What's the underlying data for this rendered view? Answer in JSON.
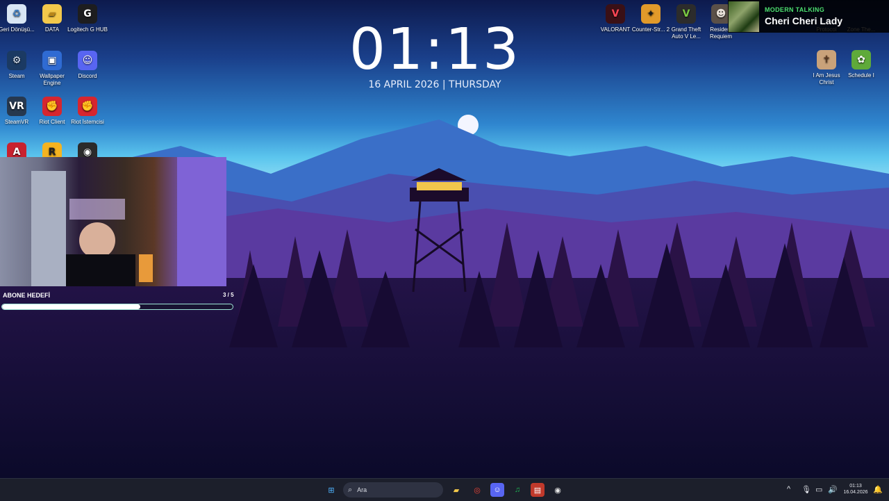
{
  "desktop_left": [
    {
      "name": "recycle-bin",
      "label": "Geri Dönüşü...",
      "glyph": "♻",
      "bg": "#d9e6f4",
      "fg": "#3b7cc4"
    },
    {
      "name": "data-folder",
      "label": "DATA",
      "glyph": "▰",
      "bg": "#f3c84b",
      "fg": "#b8861a"
    },
    {
      "name": "logitech-g-hub",
      "label": "Logitech G HUB",
      "glyph": "G",
      "bg": "#1d1d1f",
      "fg": "#ffffff"
    },
    {
      "name": "steam",
      "label": "Steam",
      "glyph": "⚙",
      "bg": "#1b3a63",
      "fg": "#dfe8f5"
    },
    {
      "name": "wallpaper-engine",
      "label": "Wallpaper Engine",
      "glyph": "▣",
      "bg": "#2f6bd3",
      "fg": "#ffffff"
    },
    {
      "name": "discord",
      "label": "Discord",
      "glyph": "☺",
      "bg": "#5865f2",
      "fg": "#ffffff"
    },
    {
      "name": "steamvr",
      "label": "SteamVR",
      "glyph": "VR",
      "bg": "#26384f",
      "fg": "#ffffff"
    },
    {
      "name": "riot-client",
      "label": "Riot Client",
      "glyph": "✊",
      "bg": "#d6262f",
      "fg": "#ffffff"
    },
    {
      "name": "riot-istemcisi",
      "label": "Riot İstemcisi",
      "glyph": "✊",
      "bg": "#d6262f",
      "fg": "#ffffff"
    },
    {
      "name": "adobe-app",
      "label": "",
      "glyph": "A",
      "bg": "#c8222f",
      "fg": "#ffffff"
    },
    {
      "name": "rockstar",
      "label": "",
      "glyph": "R",
      "bg": "#f4b321",
      "fg": "#222222"
    },
    {
      "name": "obs",
      "label": "",
      "glyph": "◉",
      "bg": "#2b2b2b",
      "fg": "#ffffff"
    }
  ],
  "desktop_right": [
    {
      "name": "valorant",
      "label": "VALORANT",
      "glyph": "V",
      "bg": "#3a1016",
      "fg": "#ff4655"
    },
    {
      "name": "counter-strike",
      "label": "Counter-Str... 2",
      "glyph": "✦",
      "bg": "#e29a2a",
      "fg": "#1a1a1a"
    },
    {
      "name": "gta-v",
      "label": "Grand Theft Auto V Le...",
      "glyph": "V",
      "bg": "#2c2c2c",
      "fg": "#7ac943"
    },
    {
      "name": "resident-evil",
      "label": "Resident Requiem",
      "glyph": "☻",
      "bg": "#5b5048",
      "fg": "#e8e0d8"
    },
    {
      "name": "protocol",
      "label": "Protocol",
      "glyph": "",
      "bg": "transparent",
      "fg": "#ffffff"
    },
    {
      "name": "zone-the",
      "label": "Zone The...",
      "glyph": "",
      "bg": "transparent",
      "fg": "#ffffff"
    },
    {
      "name": "i-am-jesus-christ",
      "label": "I Am Jesus Christ",
      "glyph": "✝",
      "bg": "#c9a27a",
      "fg": "#5a3820"
    },
    {
      "name": "schedule-i",
      "label": "Schedule I",
      "glyph": "✿",
      "bg": "#5faa3a",
      "fg": "#ffffff"
    }
  ],
  "clock": {
    "time": "01:13",
    "date": "16 APRIL 2026 | THURSDAY"
  },
  "now_playing": {
    "artist": "MODERN TALKING",
    "title": "Cheri Cheri Lady"
  },
  "goal": {
    "label": "ABONE HEDEFİ",
    "count": "3 / 5",
    "progress": 0.6
  },
  "taskbar": {
    "search_placeholder": "Ara",
    "apps": [
      {
        "name": "start",
        "glyph": "⊞",
        "fg": "#4fb3ff",
        "bg": "transparent"
      },
      {
        "name": "file-explorer",
        "glyph": "▰",
        "fg": "#f3c84b",
        "bg": "transparent"
      },
      {
        "name": "chrome",
        "glyph": "◎",
        "fg": "#ea4335",
        "bg": "transparent"
      },
      {
        "name": "discord",
        "glyph": "☺",
        "fg": "#ffffff",
        "bg": "#5865f2"
      },
      {
        "name": "spotify",
        "glyph": "♫",
        "fg": "#1db954",
        "bg": "transparent"
      },
      {
        "name": "voicemeeter",
        "glyph": "▤",
        "fg": "#ffffff",
        "bg": "#c0392b"
      },
      {
        "name": "obs",
        "glyph": "◉",
        "fg": "#e6e6e6",
        "bg": "transparent"
      }
    ],
    "tray": {
      "chevron": "^",
      "mic": "🎙",
      "network": "▭",
      "volume": "🔊",
      "time": "01:13",
      "date": "16.04.2026",
      "notification": "🔔"
    }
  }
}
